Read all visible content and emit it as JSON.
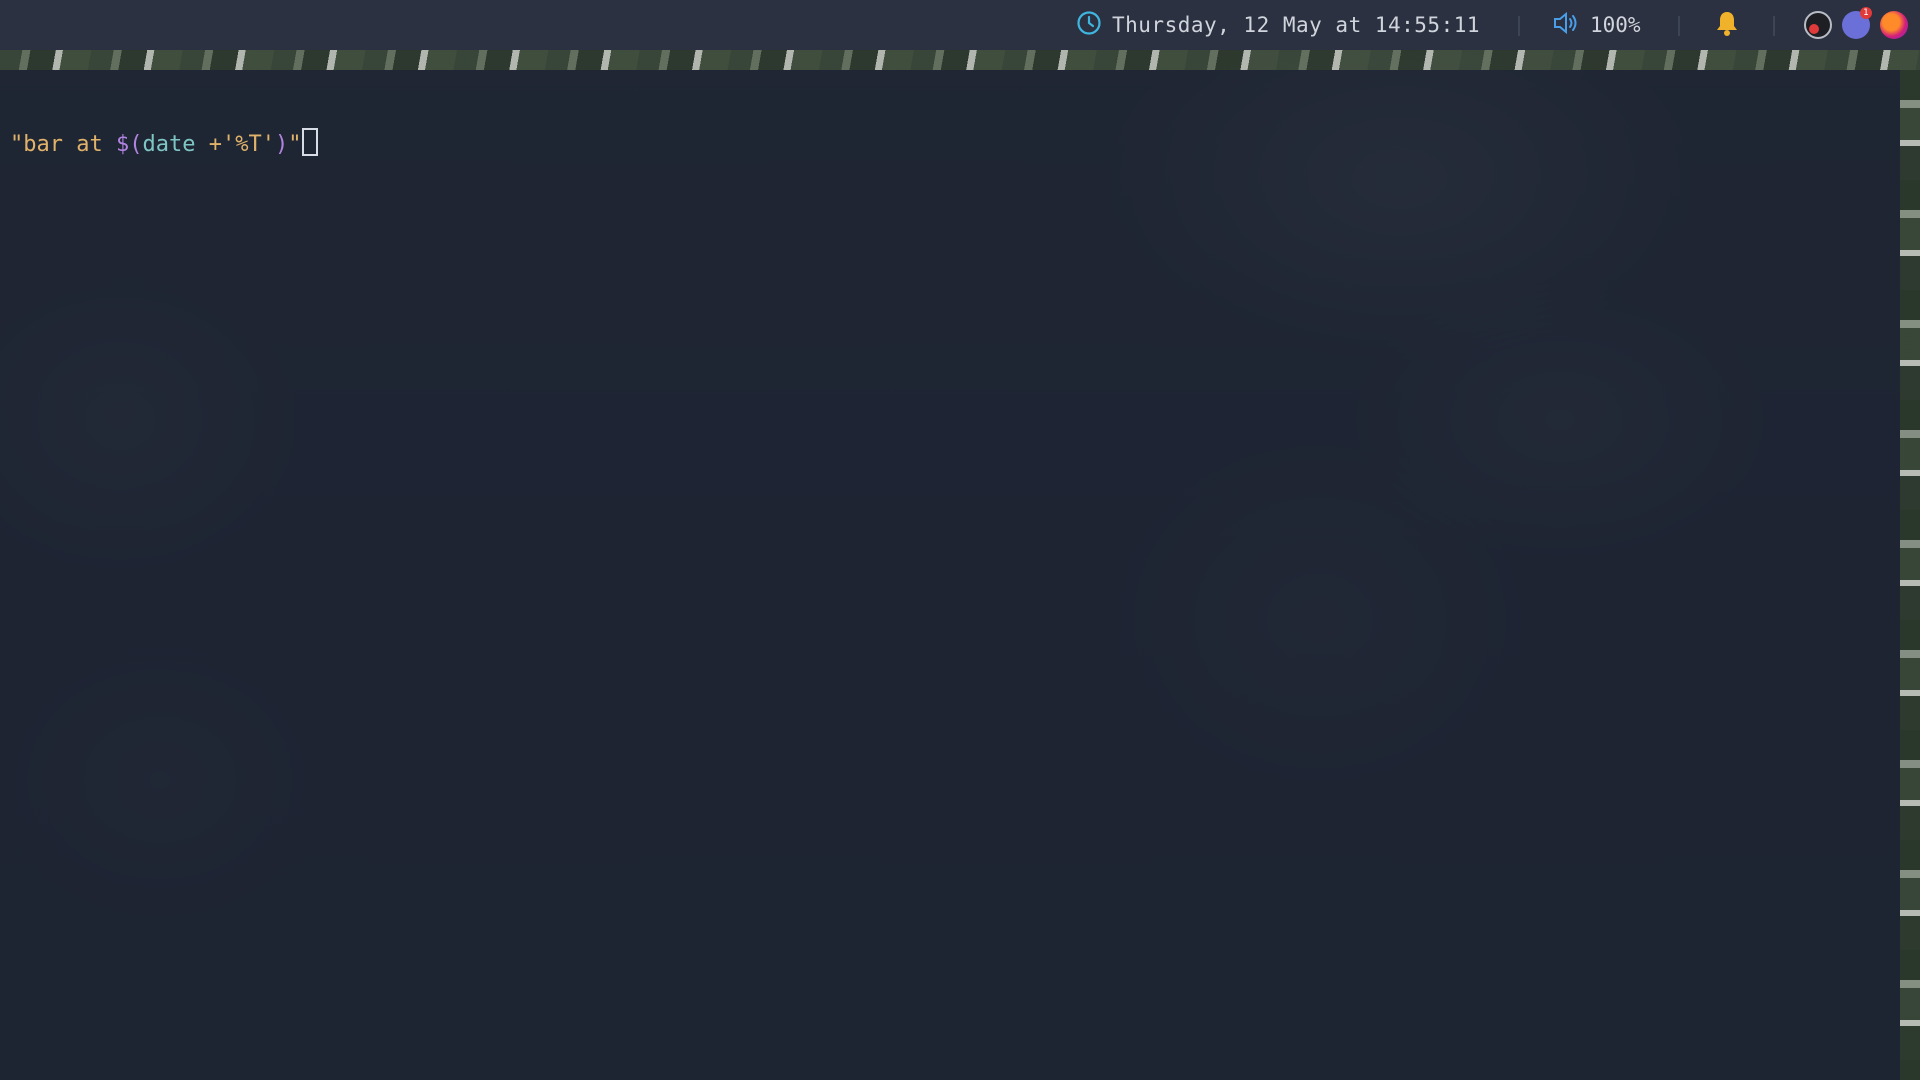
{
  "topbar": {
    "clock": {
      "icon": "clock-icon",
      "text": "Thursday, 12 May at 14:55:11"
    },
    "volume": {
      "icon": "speaker-icon",
      "text": "100%"
    },
    "notifications": {
      "icon": "bell-icon"
    },
    "tray": {
      "items": [
        {
          "icon": "tray-app-icon"
        },
        {
          "icon": "chat-app-icon",
          "badge": "1"
        },
        {
          "icon": "firefox-icon"
        }
      ]
    }
  },
  "terminal": {
    "prompt_tokens": {
      "open_quote_text": "\"bar at ",
      "subshell_start": "$(",
      "command": "date",
      "arg_plus": " +",
      "arg_format": "'%T'",
      "subshell_end": ")",
      "close_quote": "\""
    }
  },
  "colors": {
    "bar_background": "#2b3140",
    "terminal_background": "#1e2432",
    "string": "#e0b26a",
    "subshell": "#b183e0",
    "command": "#7ec6c4",
    "clock_icon": "#3fb6e0",
    "speaker_icon": "#4a9ee8",
    "bell_icon": "#f0b22a"
  }
}
